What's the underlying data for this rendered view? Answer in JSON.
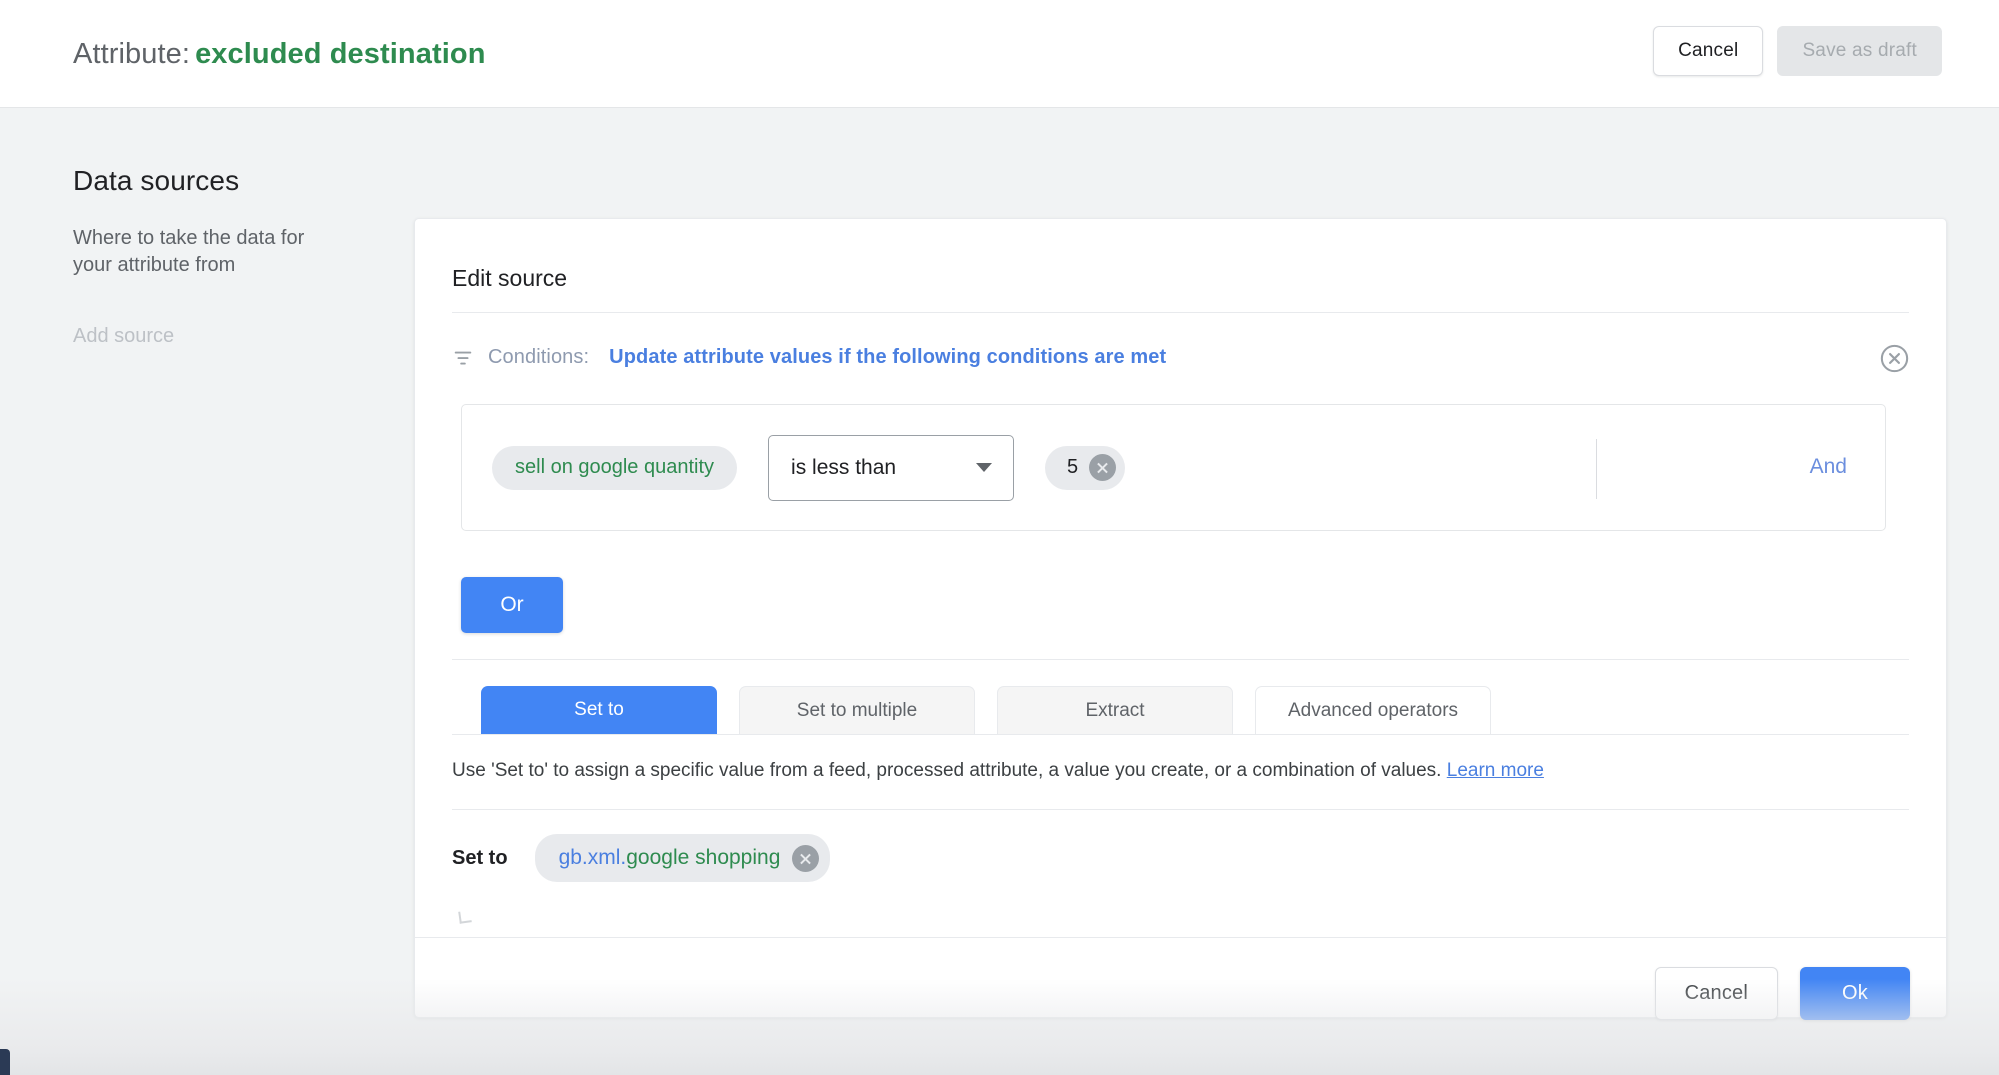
{
  "topbar": {
    "title_prefix": "Attribute:",
    "attribute_name": "excluded destination",
    "cancel_label": "Cancel",
    "save_draft_label": "Save as draft"
  },
  "sidebar": {
    "title": "Data sources",
    "subtitle": "Where to take the data for your attribute from",
    "add_source_label": "Add source"
  },
  "card": {
    "title": "Edit source",
    "conditions": {
      "icon": "filter-icon",
      "label": "Conditions:",
      "strong_label": "Update attribute values if the following conditions are met",
      "close_icon": "close-circle-icon",
      "row": {
        "field_chip": "sell on google quantity",
        "operator": "is less than",
        "value": "5",
        "and_label": "And"
      },
      "or_label": "Or"
    },
    "tabs": [
      {
        "label": "Set to",
        "active": true
      },
      {
        "label": "Set to multiple",
        "active": false
      },
      {
        "label": "Extract",
        "active": false
      },
      {
        "label": "Advanced operators",
        "active": false
      }
    ],
    "help_text": "Use 'Set to' to assign a specific value from a feed, processed attribute, a value you create, or a combination of values.",
    "help_link": "Learn more",
    "set_to": {
      "label": "Set to",
      "value_prefix": "gb.xml.",
      "value_suffix": "google shopping"
    },
    "footer": {
      "cancel_label": "Cancel",
      "ok_label": "Ok"
    }
  },
  "colors": {
    "accent_blue": "#4285f4",
    "link_blue": "#4a7fe0",
    "attribute_green": "#2e8b4f",
    "page_bg": "#f1f3f4"
  }
}
